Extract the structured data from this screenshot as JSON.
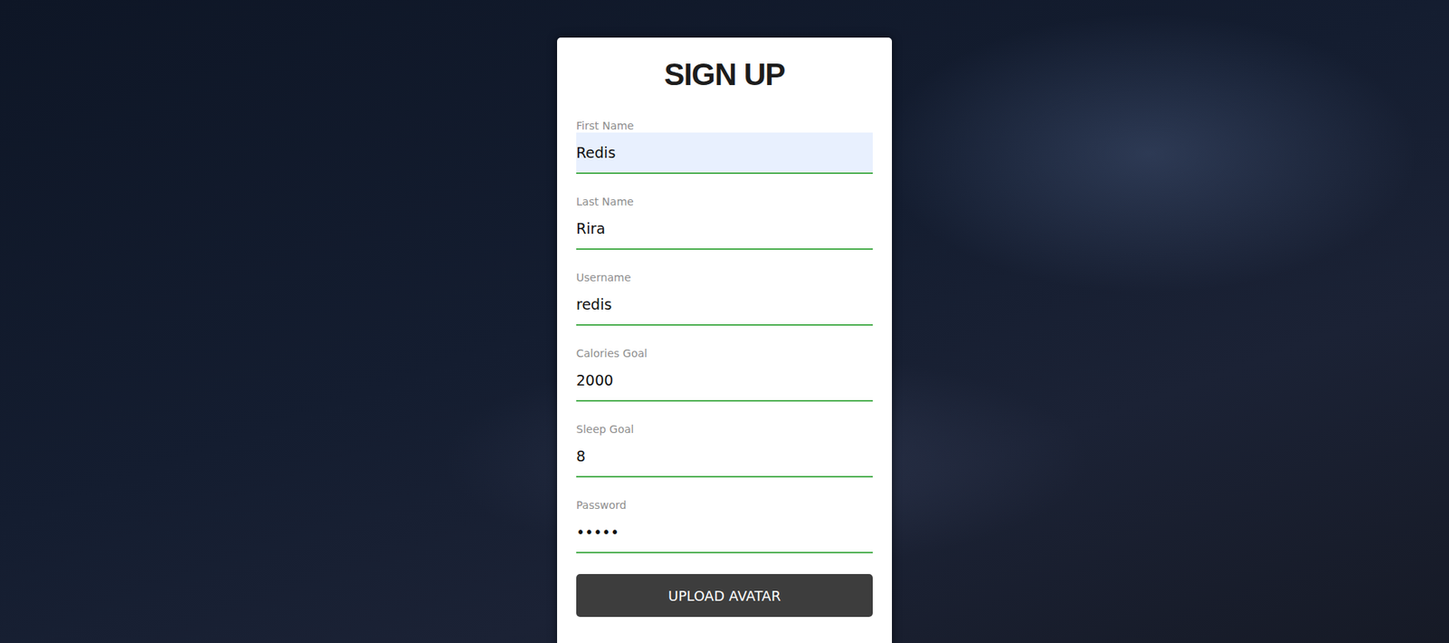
{
  "form": {
    "title": "SIGN UP",
    "fields": [
      {
        "label": "First Name",
        "value": "Redis",
        "highlighted": true
      },
      {
        "label": "Last Name",
        "value": "Rira",
        "highlighted": false
      },
      {
        "label": "Username",
        "value": "redis",
        "highlighted": false
      },
      {
        "label": "Calories Goal",
        "value": "2000",
        "highlighted": false
      },
      {
        "label": "Sleep Goal",
        "value": "8",
        "highlighted": false
      },
      {
        "label": "Password",
        "value": "•••••",
        "highlighted": false
      }
    ],
    "button": "UPLOAD AVATAR"
  }
}
